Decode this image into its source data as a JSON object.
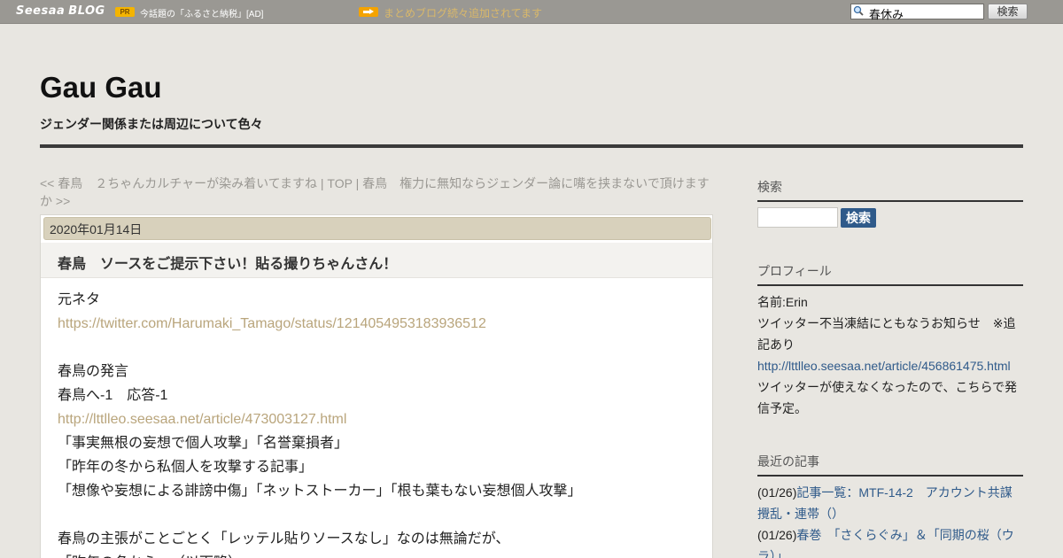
{
  "topbar": {
    "logo": "Seesaa",
    "logo_blog": "BLOG",
    "pr_badge": "PR",
    "ad_text": "今話題の「ふるさと納税」[AD]",
    "promo_link": "まとめブログ続々追加されてます",
    "search_value": "春休み",
    "search_button": "検索"
  },
  "header": {
    "title": "Gau Gau",
    "description": "ジェンダー関係または周辺について色々"
  },
  "nav": {
    "prev": "<< 春鳥　２ちゃんカルチャーが染み着いてますね",
    "sep1": " | ",
    "top": "TOP",
    "sep2": " | ",
    "next": "春鳥　権力に無知ならジェンダー論に嘴を挟まないで頂けますか >>"
  },
  "article": {
    "date": "2020年01月14日",
    "title": "春鳥　ソースをご提示下さい！貼る撮りちゃんさん！",
    "lines": [
      {
        "text": "元ネタ",
        "link": false
      },
      {
        "text": "https://twitter.com/Harumaki_Tamago/status/1214054953183936512",
        "link": true
      },
      {
        "text": "",
        "link": false
      },
      {
        "text": "春鳥の発言",
        "link": false
      },
      {
        "text": "春鳥へ-1　応答-1",
        "link": false
      },
      {
        "text": "http://lttlleo.seesaa.net/article/473003127.html",
        "link": true
      },
      {
        "text": "「事実無根の妄想で個人攻撃」「名誉棄損者」",
        "link": false
      },
      {
        "text": "「昨年の冬から私個人を攻撃する記事」",
        "link": false
      },
      {
        "text": "「想像や妄想による誹謗中傷」「ネットストーカー」「根も葉もない妄想個人攻撃」",
        "link": false
      },
      {
        "text": "",
        "link": false
      },
      {
        "text": "春鳥の主張がことごとく「レッテル貼りソースなし」なのは無論だが、",
        "link": false
      },
      {
        "text": "「昨年の冬から…（以下略）」",
        "link": false
      }
    ]
  },
  "sidebar": {
    "search_heading": "検索",
    "search_button": "検索",
    "profile_heading": "プロフィール",
    "profile_name": "名前:Erin",
    "profile_notice": "ツイッター不当凍結にともなうお知らせ　※追記あり",
    "profile_link": "http://lttlleo.seesaa.net/article/456861475.html",
    "profile_note": "ツイッターが使えなくなったので、こちらで発信予定。",
    "recent_heading": "最近の記事",
    "recent": [
      {
        "date": "(01/26)",
        "title": "記事一覧：MTF-14-2　アカウント共謀攪乱・連帯（）"
      },
      {
        "date": "(01/26)",
        "title": "春巻　「さくらぐみ」＆「同期の桜（ウラ）」"
      }
    ]
  }
}
